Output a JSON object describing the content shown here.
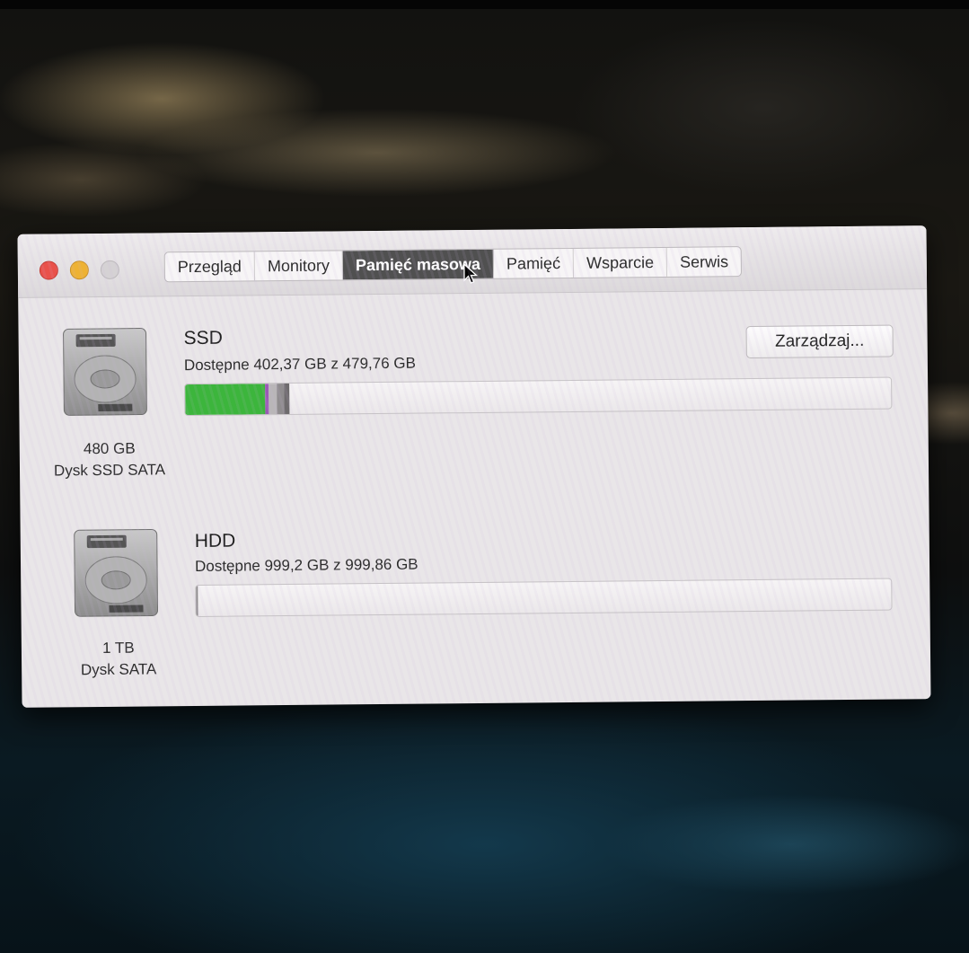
{
  "tabs": [
    {
      "label": "Przegląd"
    },
    {
      "label": "Monitory"
    },
    {
      "label": "Pamięć masowa"
    },
    {
      "label": "Pamięć"
    },
    {
      "label": "Wsparcie"
    },
    {
      "label": "Serwis"
    }
  ],
  "active_tab": "Pamięć masowa",
  "drives": [
    {
      "name": "SSD",
      "available": "Dostępne 402,37 GB z 479,76 GB",
      "capacity": "480 GB",
      "type": "Dysk SSD SATA",
      "usage_segments": [
        {
          "fraction": 0.113,
          "color": "#3cb53c"
        },
        {
          "fraction": 0.005,
          "color": "#9b59b6"
        },
        {
          "fraction": 0.012,
          "color": "#b9b6b8"
        },
        {
          "fraction": 0.01,
          "color": "#8f8c8e"
        },
        {
          "fraction": 0.007,
          "color": "#6e6b6d"
        }
      ]
    },
    {
      "name": "HDD",
      "available": "Dostępne 999,2 GB z 999,86 GB",
      "capacity": "1 TB",
      "type": "Dysk SATA",
      "usage_segments": [
        {
          "fraction": 0.002,
          "color": "#8f8c8e"
        }
      ]
    }
  ],
  "manage_button": "Zarządzaj..."
}
